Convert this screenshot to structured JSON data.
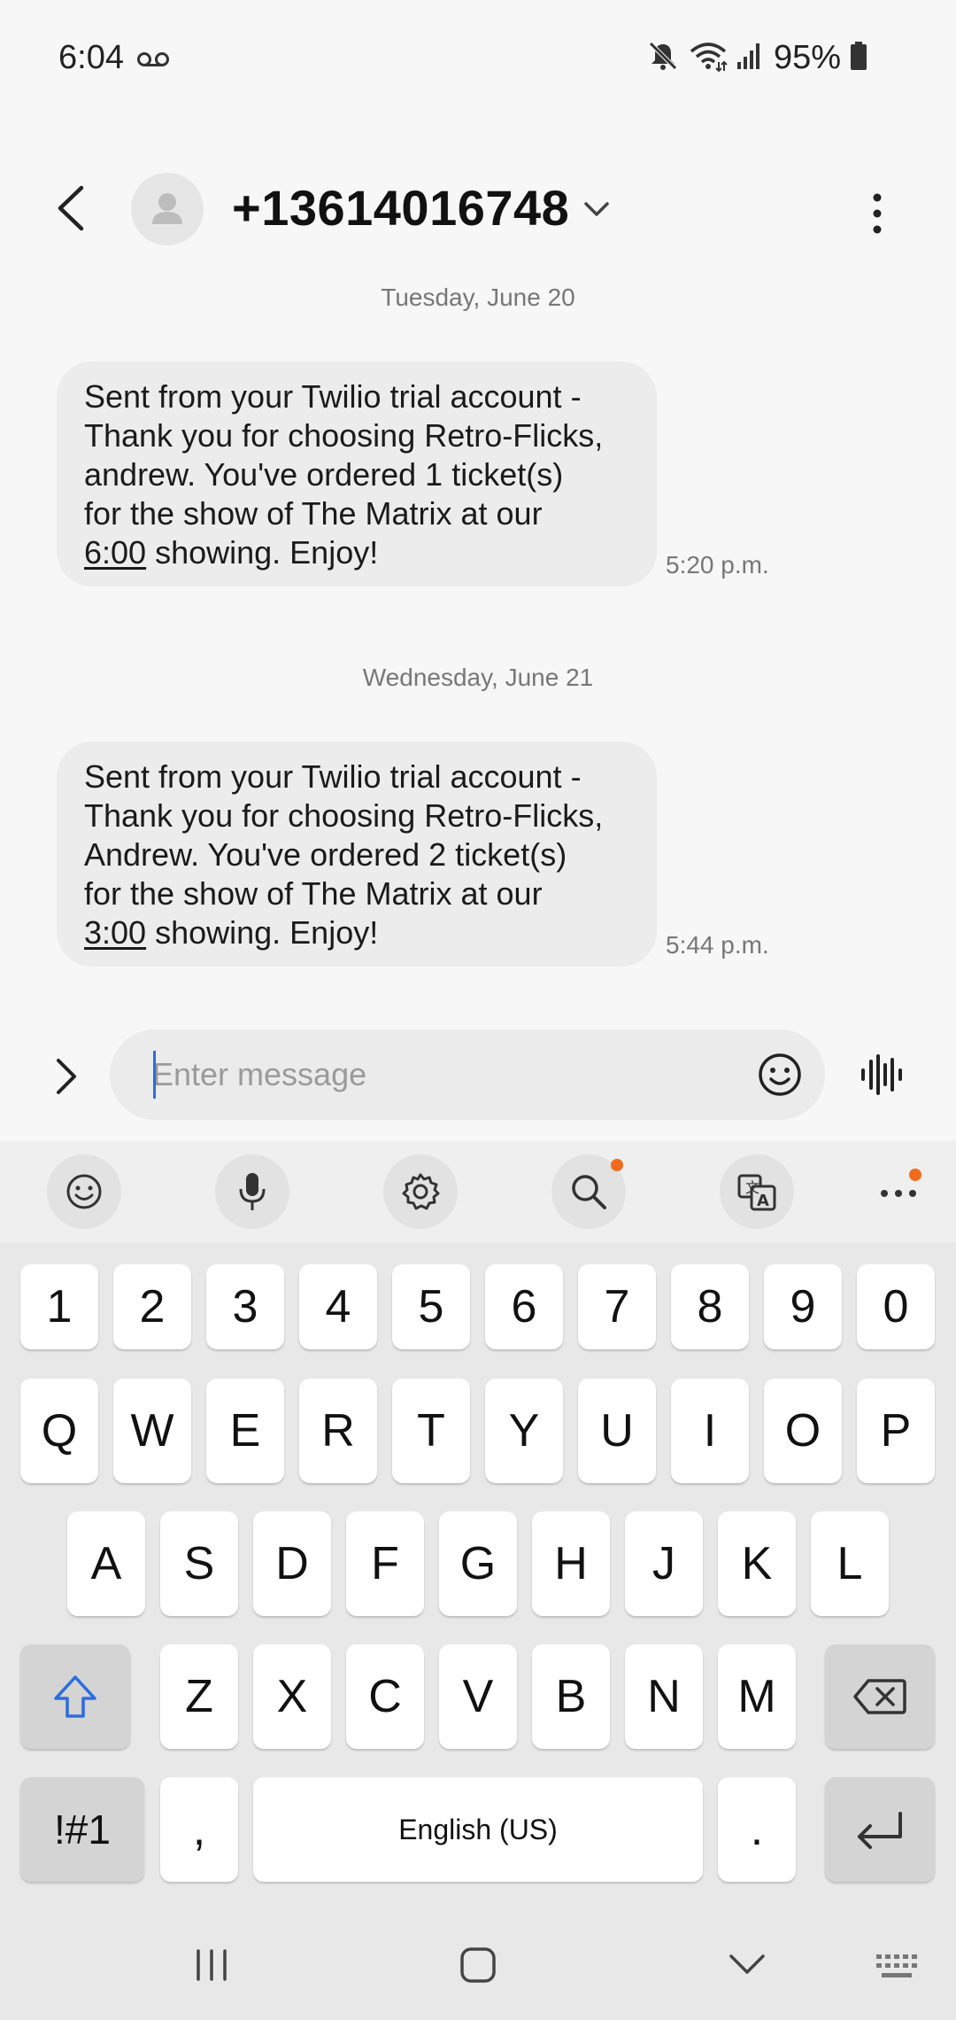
{
  "status_bar": {
    "time": "6:04",
    "battery": "95%"
  },
  "header": {
    "contact": "+13614016748"
  },
  "conversation": [
    {
      "date": "Tuesday, June 20",
      "lines": [
        "Sent from your Twilio trial account -",
        "Thank you for choosing Retro-Flicks,",
        "andrew. You've ordered 1 ticket(s)",
        "for the show of The Matrix at our"
      ],
      "link": "6:00",
      "tail": " showing. Enjoy!",
      "time": "5:20 p.m."
    },
    {
      "date": "Wednesday, June 21",
      "lines": [
        "Sent from your Twilio trial account -",
        "Thank you for choosing Retro-Flicks,",
        "Andrew. You've ordered 2 ticket(s)",
        "for the show of The Matrix at our"
      ],
      "link": "3:00",
      "tail": " showing. Enjoy!",
      "time": "5:44 p.m."
    }
  ],
  "composer": {
    "placeholder": "Enter message",
    "value": ""
  },
  "keyboard": {
    "row_numbers": [
      "1",
      "2",
      "3",
      "4",
      "5",
      "6",
      "7",
      "8",
      "9",
      "0"
    ],
    "row_top": [
      "Q",
      "W",
      "E",
      "R",
      "T",
      "Y",
      "U",
      "I",
      "O",
      "P"
    ],
    "row_mid": [
      "A",
      "S",
      "D",
      "F",
      "G",
      "H",
      "J",
      "K",
      "L"
    ],
    "row_bottom": [
      "Z",
      "X",
      "C",
      "V",
      "B",
      "N",
      "M"
    ],
    "symbols_key": "!#1",
    "comma_key": ",",
    "space_label": "English (US)",
    "period_key": "."
  },
  "icons": {
    "status": [
      "voicemail-icon",
      "mute-icon",
      "wifi-icon",
      "signal-icon",
      "battery-icon"
    ],
    "toolbar": [
      "emoji-icon",
      "microphone-icon",
      "settings-icon",
      "search-icon",
      "translate-icon",
      "more-icon"
    ],
    "accent": "#f26b1d",
    "cursor": "#2b6de0"
  }
}
